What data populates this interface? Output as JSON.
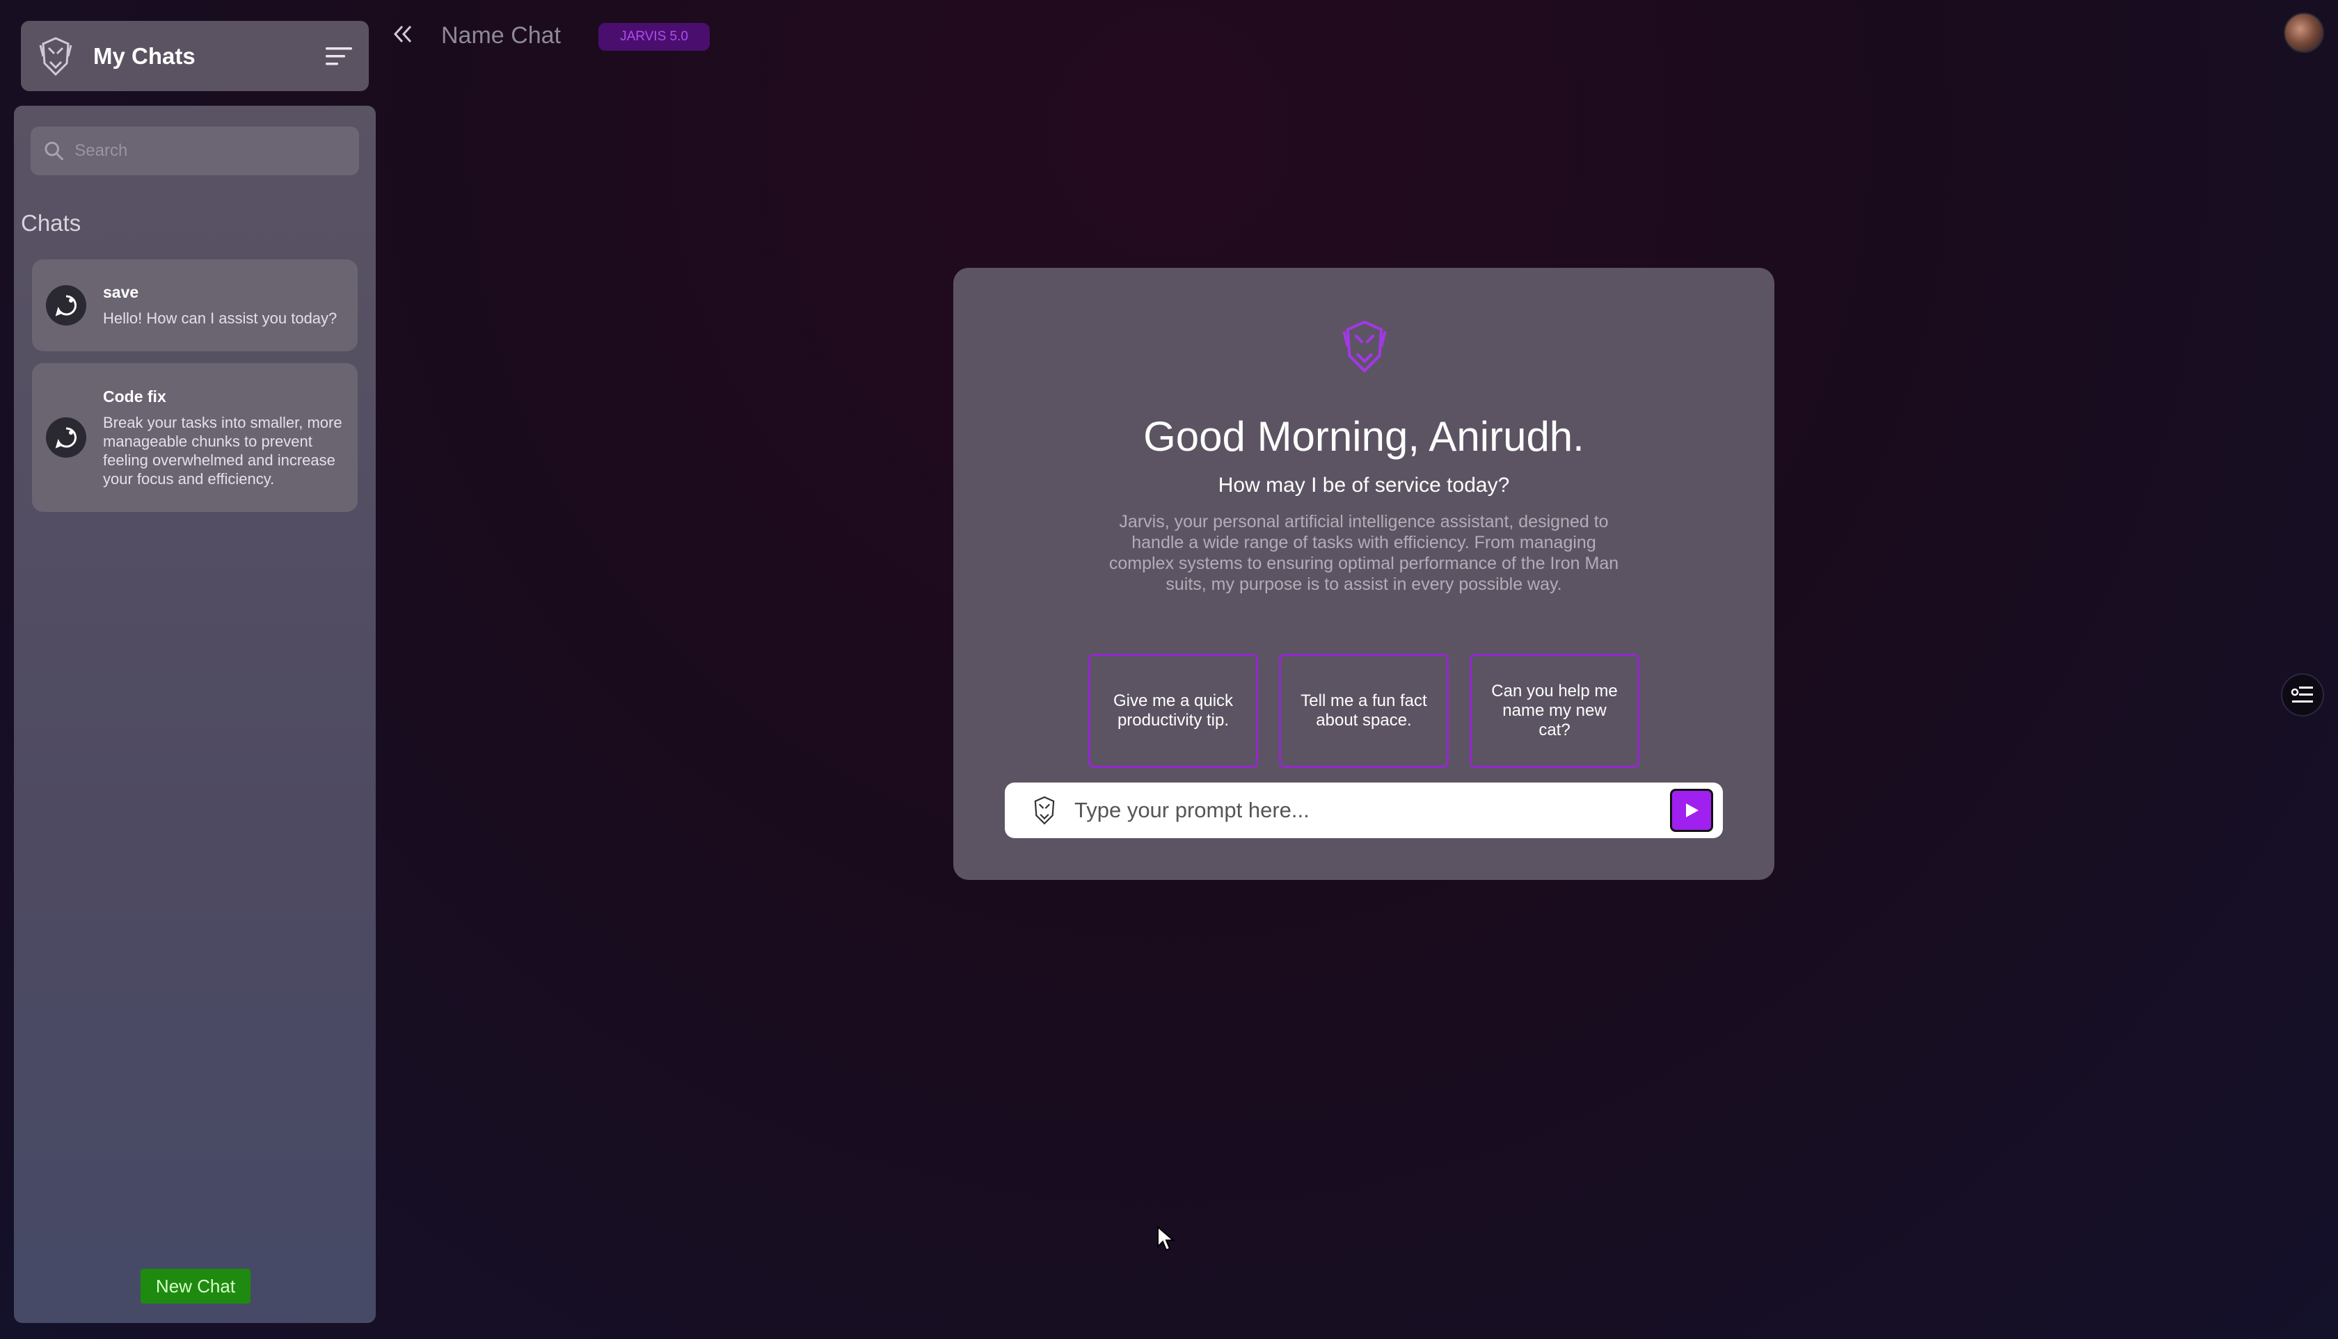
{
  "sidebar": {
    "title": "My Chats",
    "search_placeholder": "Search",
    "chats_heading": "Chats",
    "chats": [
      {
        "title": "save",
        "preview": "Hello! How can I assist you today?"
      },
      {
        "title": "Code fix",
        "preview": "Break your tasks into smaller, more manageable chunks to prevent feeling overwhelmed and increase your focus and efficiency."
      }
    ],
    "new_chat_label": "New Chat"
  },
  "header": {
    "chat_name": "Name Chat",
    "model_badge": "JARVIS 5.0"
  },
  "welcome": {
    "greeting": "Good Morning, Anirudh.",
    "subtitle": "How may I be of service today?",
    "description": "Jarvis, your personal artificial intelligence assistant, designed to handle a wide range of tasks with efficiency. From managing complex systems to ensuring optimal performance of the Iron Man suits, my purpose is to assist in every possible way.",
    "suggestions": [
      "Give me a quick productivity tip.",
      "Tell me a fun fact about space.",
      "Can you help me name my new cat?"
    ],
    "prompt_placeholder": "Type your prompt here..."
  },
  "colors": {
    "accent": "#a020f0",
    "new_chat_green": "#1f8a10",
    "badge_bg": "#4a0f6e"
  },
  "icons": {
    "logo": "jarvis-mask-icon",
    "menu": "sort-lines-icon",
    "search": "search-icon",
    "chat": "chat-bubble-icon",
    "collapse": "double-chevron-left-icon",
    "send": "send-arrow-icon",
    "side_toggle": "settings-list-icon",
    "avatar": "user-avatar"
  }
}
